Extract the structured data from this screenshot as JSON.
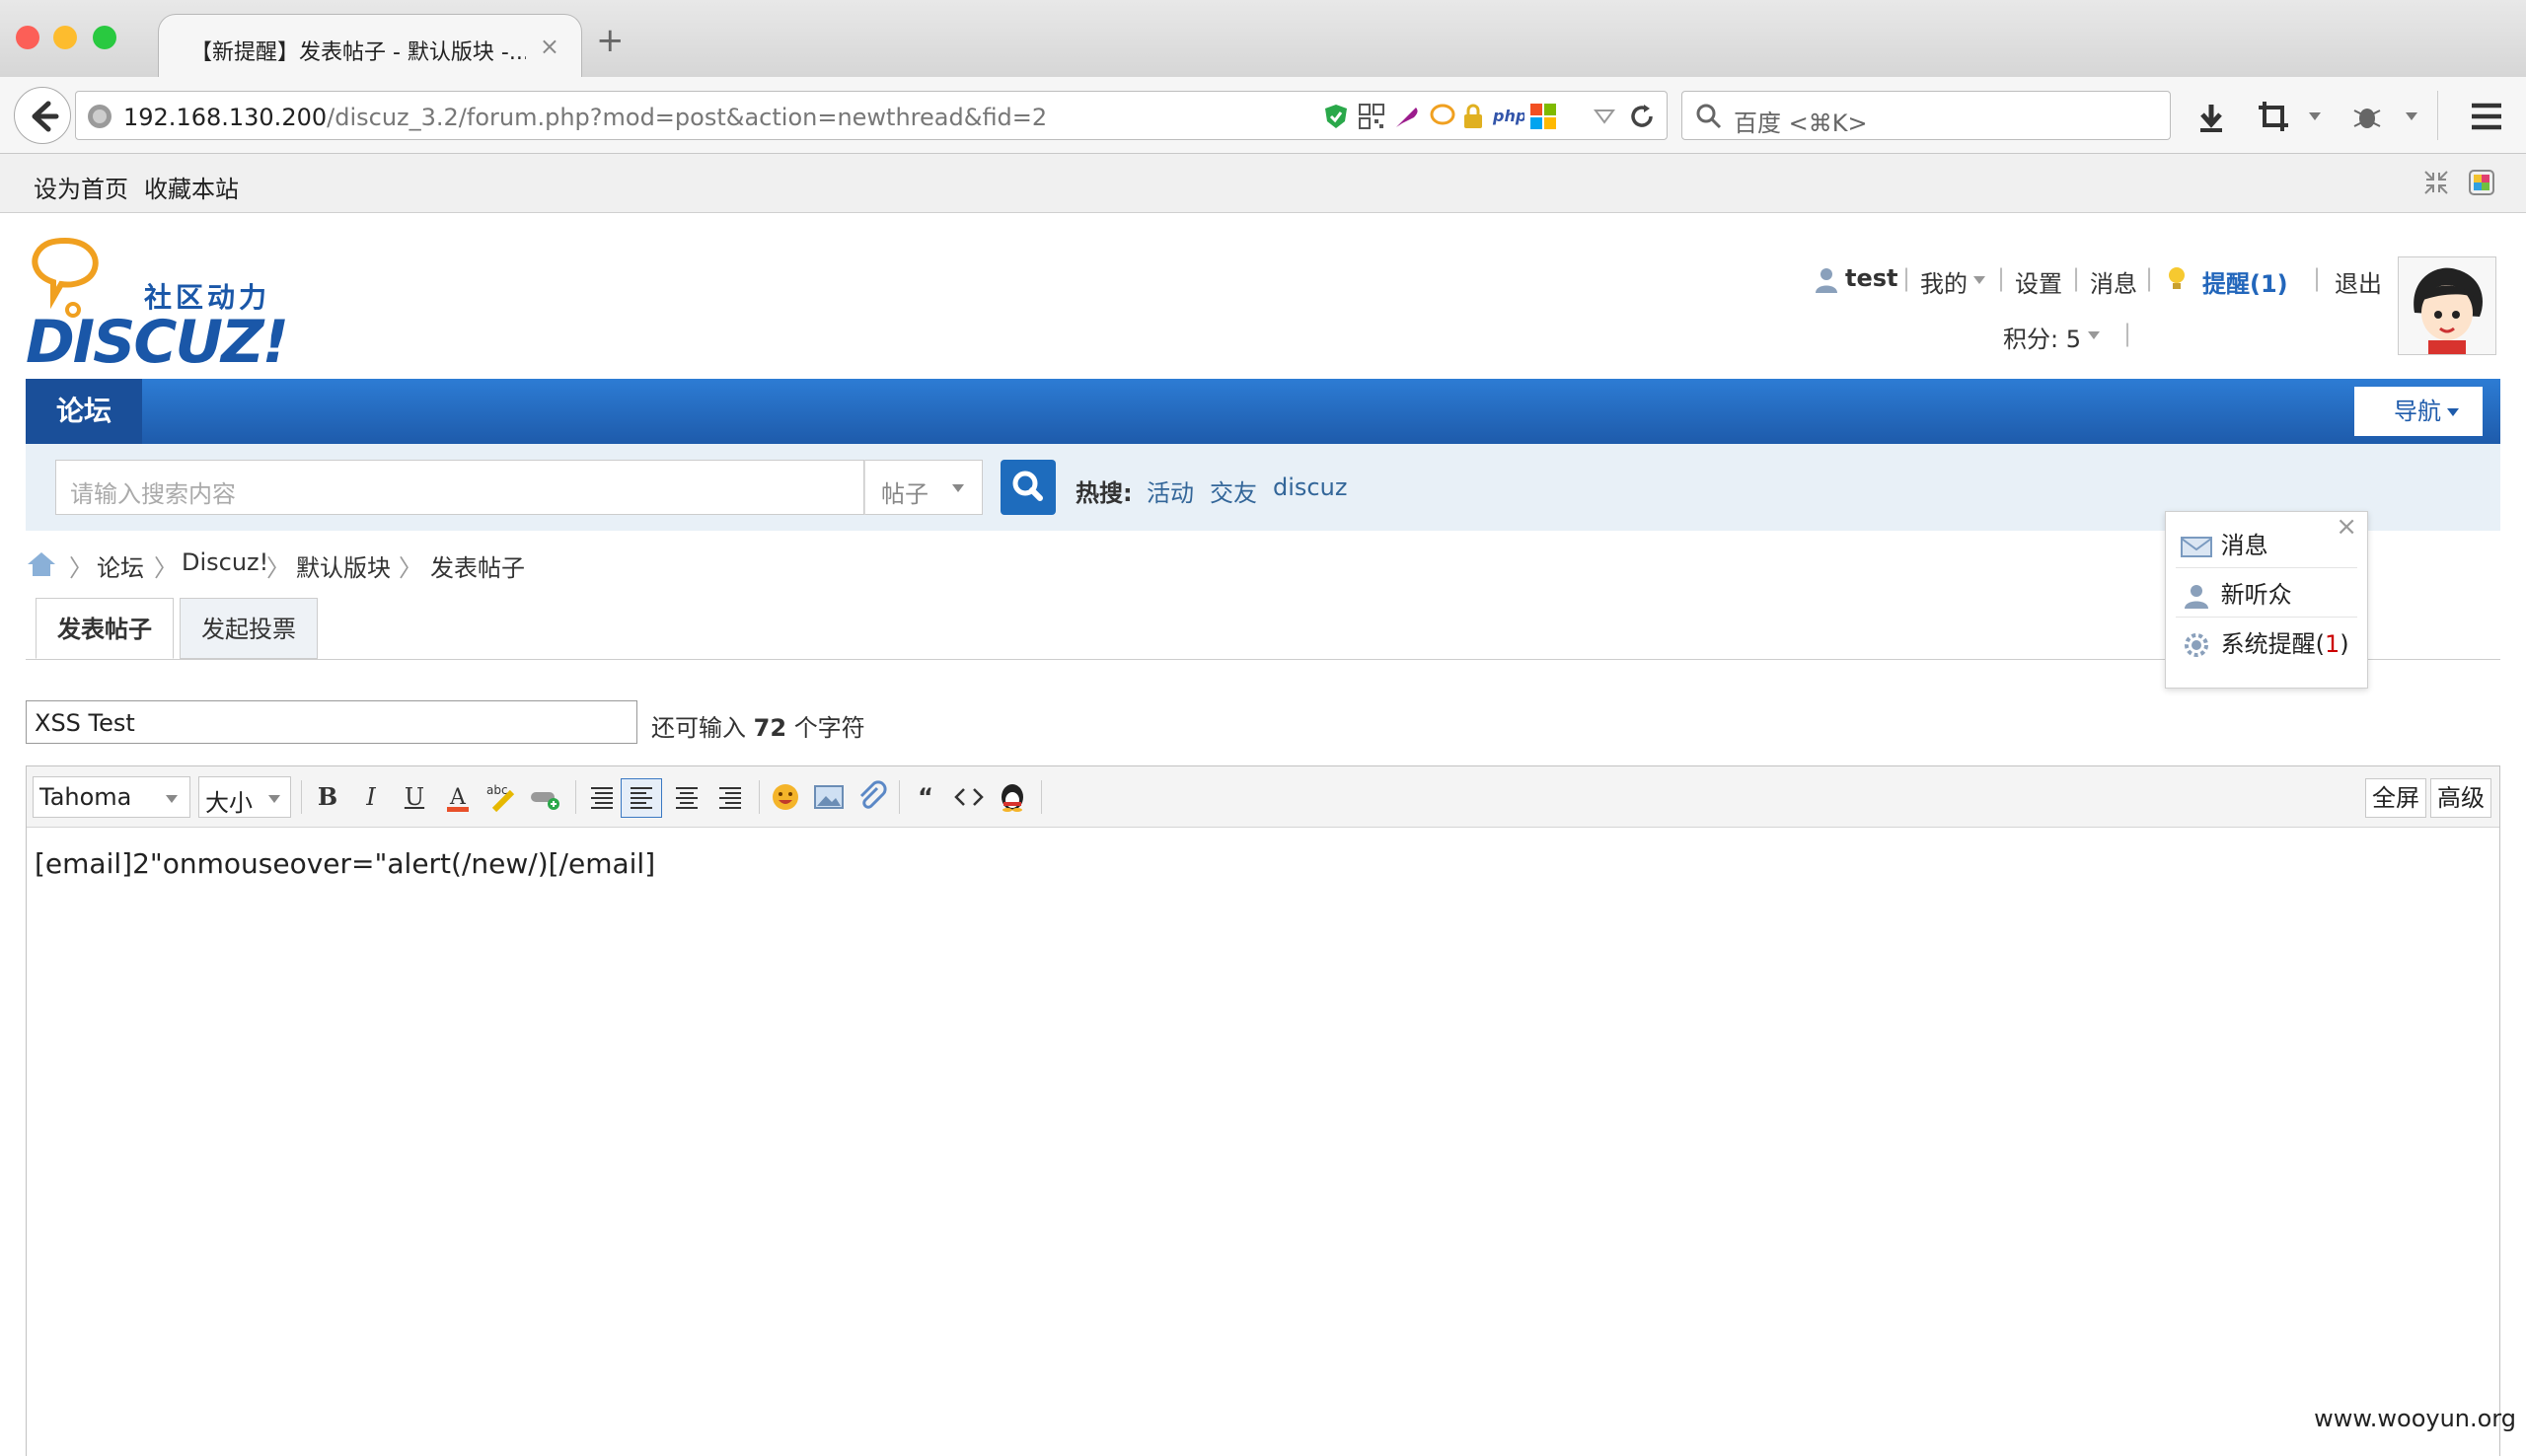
{
  "browser": {
    "tab_title": "【新提醒】发表帖子 - 默认版块 -...",
    "tab_close": "×",
    "new_tab": "+",
    "url_host": "192.168.130.200",
    "url_path": "/discuz_3.2/forum.php?mod=post&action=newthread&fid=2",
    "search_placeholder": "百度 <⌘K>",
    "bookmarks": [
      "设为首页",
      "收藏本站"
    ]
  },
  "site": {
    "logo": "DISCUZ!",
    "logo_sub": "社区动力"
  },
  "user_bar": {
    "username": "test",
    "my": "我的",
    "settings": "设置",
    "messages": "消息",
    "reminders": "提醒(1)",
    "logout": "退出",
    "points_label": "积分: 5"
  },
  "nav": {
    "forum": "论坛",
    "guide": "导航"
  },
  "search": {
    "placeholder": "请输入搜索内容",
    "type": "帖子",
    "hot_label": "热搜:",
    "hot_terms": [
      "活动",
      "交友",
      "discuz"
    ]
  },
  "breadcrumb": [
    "论坛",
    "Discuz!",
    "默认版块",
    "发表帖子"
  ],
  "post_tabs": [
    "发表帖子",
    "发起投票"
  ],
  "subject": {
    "value": "XSS Test",
    "hint_prefix": "还可输入",
    "hint_count": "72",
    "hint_suffix": "个字符"
  },
  "editor": {
    "font": "Tahoma",
    "size": "大小",
    "fullscreen": "全屏",
    "advanced": "高级",
    "content": "[email]2\"onmouseover=\"alert(/new/)[/email]"
  },
  "popup": {
    "close": "×",
    "items": [
      "消息",
      "新听众",
      "系统提醒"
    ],
    "system_count": "1"
  },
  "watermark": "www.wooyun.org"
}
